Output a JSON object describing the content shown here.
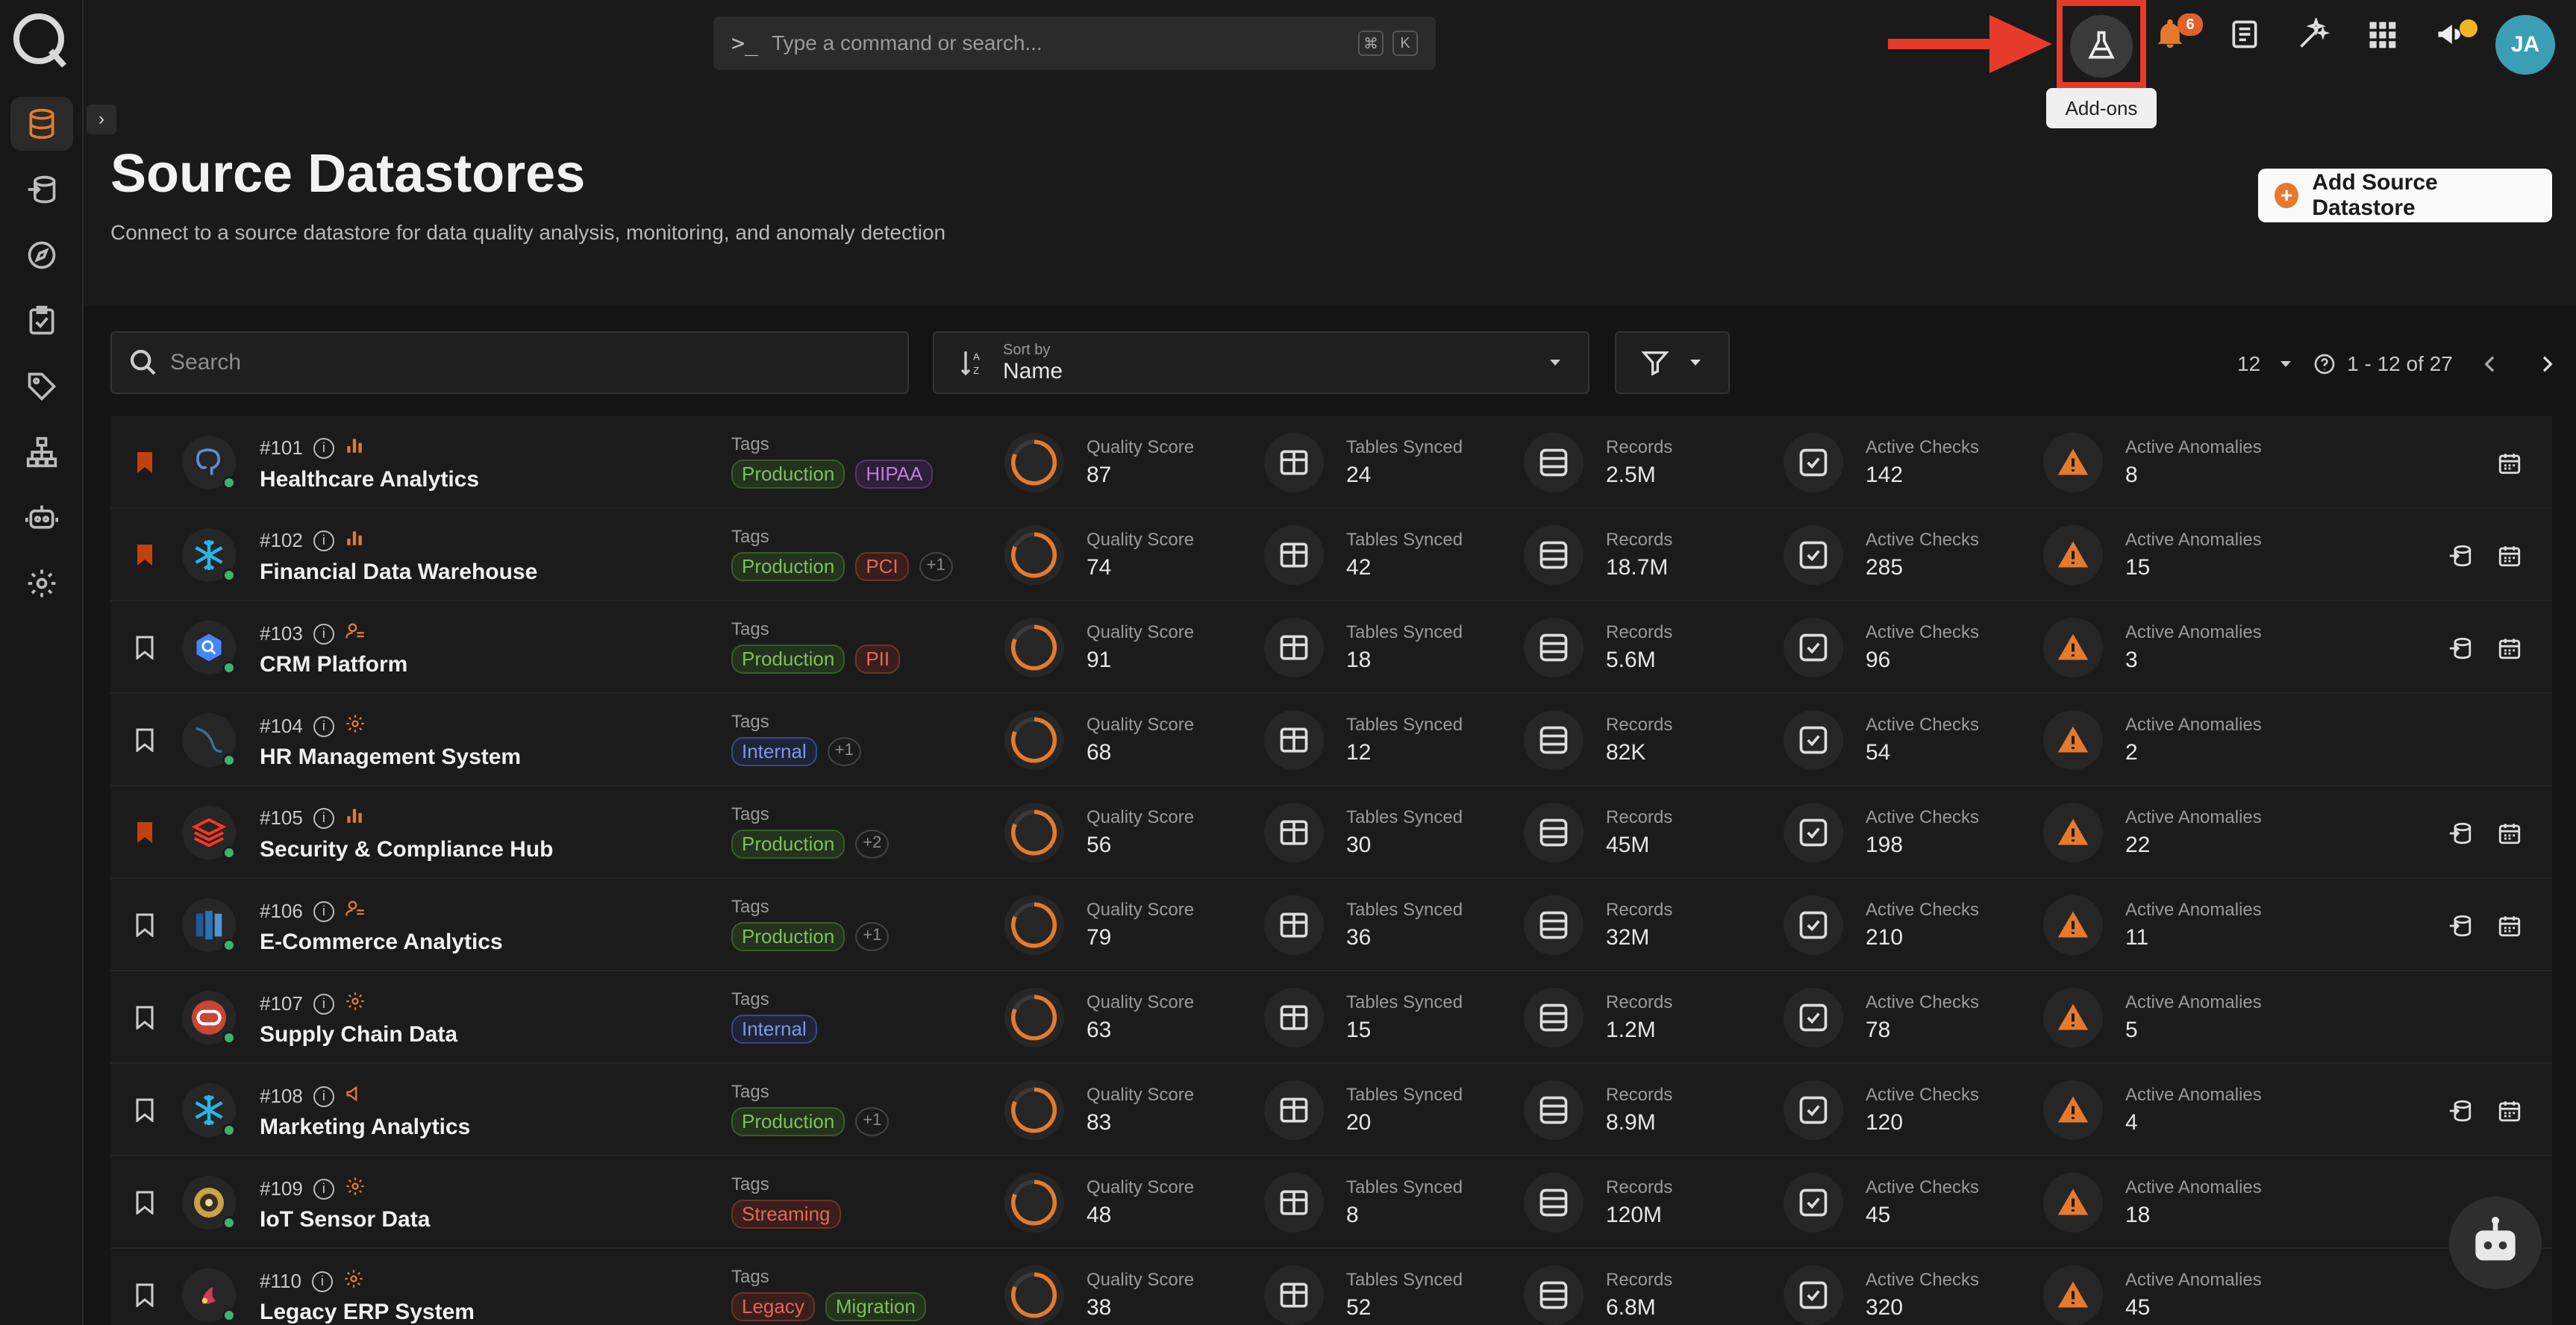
{
  "command_bar": {
    "prompt": ">_",
    "placeholder": "Type a command or search...",
    "shortcut_mod": "⌘",
    "shortcut_key": "K"
  },
  "top_icons": {
    "addons_tooltip": "Add-ons",
    "notifications_count": "6",
    "avatar_initials": "JA"
  },
  "header": {
    "title": "Source Datastores",
    "subtitle": "Connect to a source datastore for data quality analysis, monitoring, and anomaly detection",
    "add_button": "Add Source Datastore"
  },
  "toolbar": {
    "search_placeholder": "Search",
    "sort_label": "Sort by",
    "sort_value": "Name",
    "page_size": "12",
    "range": "1 - 12 of 27"
  },
  "labels": {
    "tags": "Tags",
    "quality": "Quality Score",
    "tables": "Tables Synced",
    "records": "Records",
    "checks": "Active Checks",
    "anomalies": "Active Anomalies"
  },
  "colors": {
    "accent": "#e47a2e",
    "highlight": "#e63b2a",
    "status_ok": "#3cb371"
  },
  "datastores": [
    {
      "id": "#101",
      "name": "Healthcare Analytics",
      "bookmarked": true,
      "type_icon": "chart-icon",
      "logo": "postgres-icon",
      "tags": [
        {
          "t": "Production",
          "c": "green"
        },
        {
          "t": "HIPAA",
          "c": "purple"
        }
      ],
      "quality": "87",
      "tables": "24",
      "records": "2.5M",
      "checks": "142",
      "anomalies": "8",
      "actions": [
        "calendar"
      ]
    },
    {
      "id": "#102",
      "name": "Financial Data Warehouse",
      "bookmarked": true,
      "type_icon": "chart-icon",
      "logo": "snowflake-icon",
      "tags": [
        {
          "t": "Production",
          "c": "green"
        },
        {
          "t": "PCI",
          "c": "red"
        },
        {
          "t": "+1",
          "c": "more"
        }
      ],
      "quality": "74",
      "tables": "42",
      "records": "18.7M",
      "checks": "285",
      "anomalies": "15",
      "actions": [
        "sync",
        "calendar"
      ]
    },
    {
      "id": "#103",
      "name": "CRM Platform",
      "bookmarked": false,
      "type_icon": "user-icon",
      "logo": "bigquery-icon",
      "tags": [
        {
          "t": "Production",
          "c": "green"
        },
        {
          "t": "PII",
          "c": "red"
        }
      ],
      "quality": "91",
      "tables": "18",
      "records": "5.6M",
      "checks": "96",
      "anomalies": "3",
      "actions": [
        "sync",
        "calendar"
      ]
    },
    {
      "id": "#104",
      "name": "HR Management System",
      "bookmarked": false,
      "type_icon": "gear-icon",
      "logo": "mysql-icon",
      "tags": [
        {
          "t": "Internal",
          "c": "blue"
        },
        {
          "t": "+1",
          "c": "more"
        }
      ],
      "quality": "68",
      "tables": "12",
      "records": "82K",
      "checks": "54",
      "anomalies": "2",
      "actions": []
    },
    {
      "id": "#105",
      "name": "Security & Compliance Hub",
      "bookmarked": true,
      "type_icon": "chart-icon",
      "logo": "databricks-icon",
      "tags": [
        {
          "t": "Production",
          "c": "green"
        },
        {
          "t": "+2",
          "c": "more"
        }
      ],
      "quality": "56",
      "tables": "30",
      "records": "45M",
      "checks": "198",
      "anomalies": "22",
      "actions": [
        "sync",
        "calendar"
      ]
    },
    {
      "id": "#106",
      "name": "E-Commerce Analytics",
      "bookmarked": false,
      "type_icon": "user-icon",
      "logo": "redshift-icon",
      "tags": [
        {
          "t": "Production",
          "c": "green"
        },
        {
          "t": "+1",
          "c": "more"
        }
      ],
      "quality": "79",
      "tables": "36",
      "records": "32M",
      "checks": "210",
      "anomalies": "11",
      "actions": [
        "sync",
        "calendar"
      ]
    },
    {
      "id": "#107",
      "name": "Supply Chain Data",
      "bookmarked": false,
      "type_icon": "gear-icon",
      "logo": "oracle-icon",
      "tags": [
        {
          "t": "Internal",
          "c": "blue"
        }
      ],
      "quality": "63",
      "tables": "15",
      "records": "1.2M",
      "checks": "78",
      "anomalies": "5",
      "actions": []
    },
    {
      "id": "#108",
      "name": "Marketing Analytics",
      "bookmarked": false,
      "type_icon": "megaphone-icon",
      "logo": "snowflake-icon",
      "tags": [
        {
          "t": "Production",
          "c": "green"
        },
        {
          "t": "+1",
          "c": "more"
        }
      ],
      "quality": "83",
      "tables": "20",
      "records": "8.9M",
      "checks": "120",
      "anomalies": "4",
      "actions": [
        "sync",
        "calendar"
      ]
    },
    {
      "id": "#109",
      "name": "IoT Sensor Data",
      "bookmarked": false,
      "type_icon": "gear-icon",
      "logo": "iot-icon",
      "tags": [
        {
          "t": "Streaming",
          "c": "red"
        }
      ],
      "quality": "48",
      "tables": "8",
      "records": "120M",
      "checks": "45",
      "anomalies": "18",
      "actions": []
    },
    {
      "id": "#110",
      "name": "Legacy ERP System",
      "bookmarked": false,
      "type_icon": "gear-icon",
      "logo": "legacy-icon",
      "tags": [
        {
          "t": "Legacy",
          "c": "red"
        },
        {
          "t": "Migration",
          "c": "green"
        }
      ],
      "quality": "38",
      "tables": "52",
      "records": "6.8M",
      "checks": "320",
      "anomalies": "45",
      "actions": []
    }
  ]
}
